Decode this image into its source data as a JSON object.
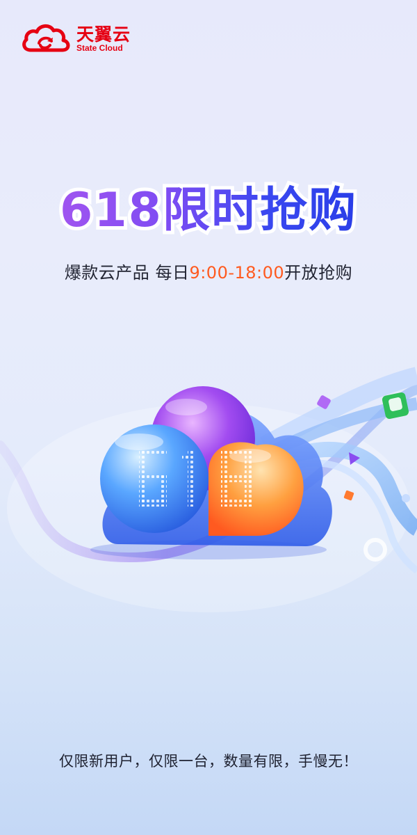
{
  "brand": {
    "name_cn": "天翼云",
    "name_en": "State Cloud",
    "color": "#e60012",
    "logo_icon": "cloud-logo-icon"
  },
  "headline": {
    "text": "618限时抢购",
    "gradient": [
      "#a055f0",
      "#2a3ee8"
    ]
  },
  "subline": {
    "prefix": "爆款云产品 每日",
    "time": "9:00-18:00",
    "suffix": "开放抢购",
    "time_color": "#ff5a1f"
  },
  "hero": {
    "digits": "618",
    "icon": "cloud-618-icon"
  },
  "footer": {
    "text": "仅限新用户，仅限一台，数量有限，手慢无！"
  }
}
